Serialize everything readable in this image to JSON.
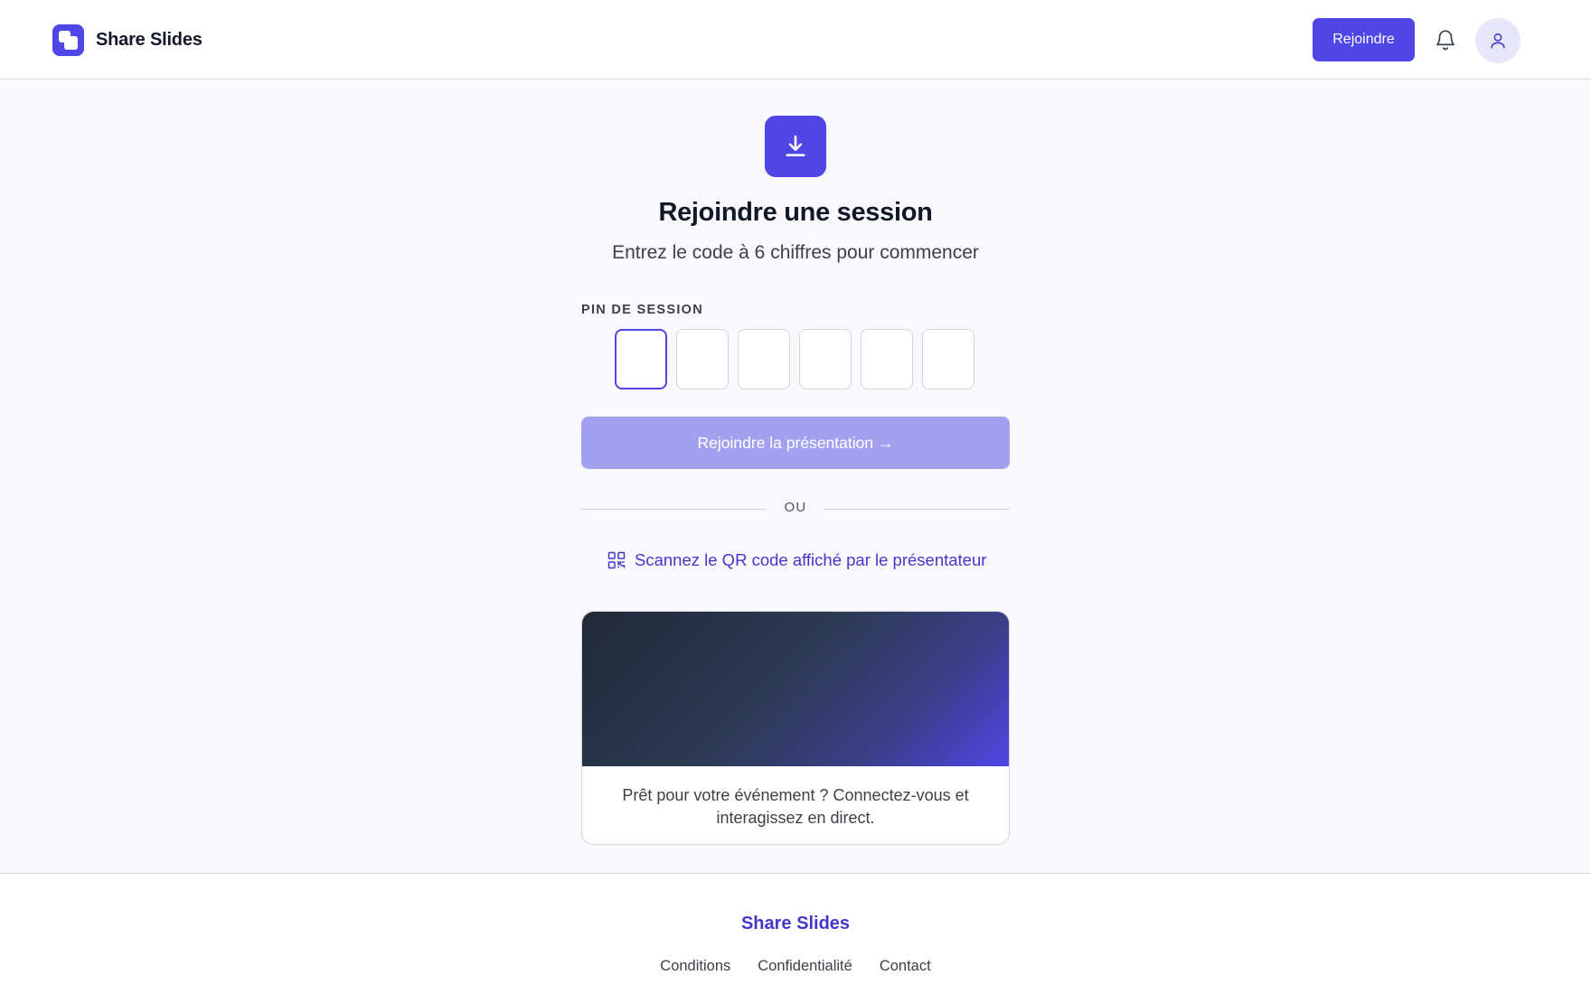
{
  "header": {
    "brand": "Share Slides",
    "join_label": "Rejoindre",
    "icons": [
      "logo-icon",
      "bell-icon",
      "user-icon"
    ]
  },
  "main": {
    "hero_icon": "download-icon",
    "title": "Rejoindre une session",
    "subtitle": "Entrez le code à 6 chiffres pour commencer",
    "pin_label": "PIN DE SESSION",
    "pin_values": [
      "",
      "",
      "",
      "",
      "",
      ""
    ],
    "submit_label": "Rejoindre la présentation →",
    "divider_label": "OU",
    "qr_label": "Scannez le QR code affiché par le présentateur",
    "card_text": "Prêt pour votre événement ? Connectez-vous et interagissez en direct."
  },
  "footer": {
    "brand": "Share Slides",
    "links": [
      "Conditions",
      "Confidentialité",
      "Contact"
    ]
  },
  "colors": {
    "accent": "#4f46e5",
    "accent_disabled": "#a3a0ef",
    "link": "#4338ca",
    "page_bg": "#f9f8fd"
  }
}
